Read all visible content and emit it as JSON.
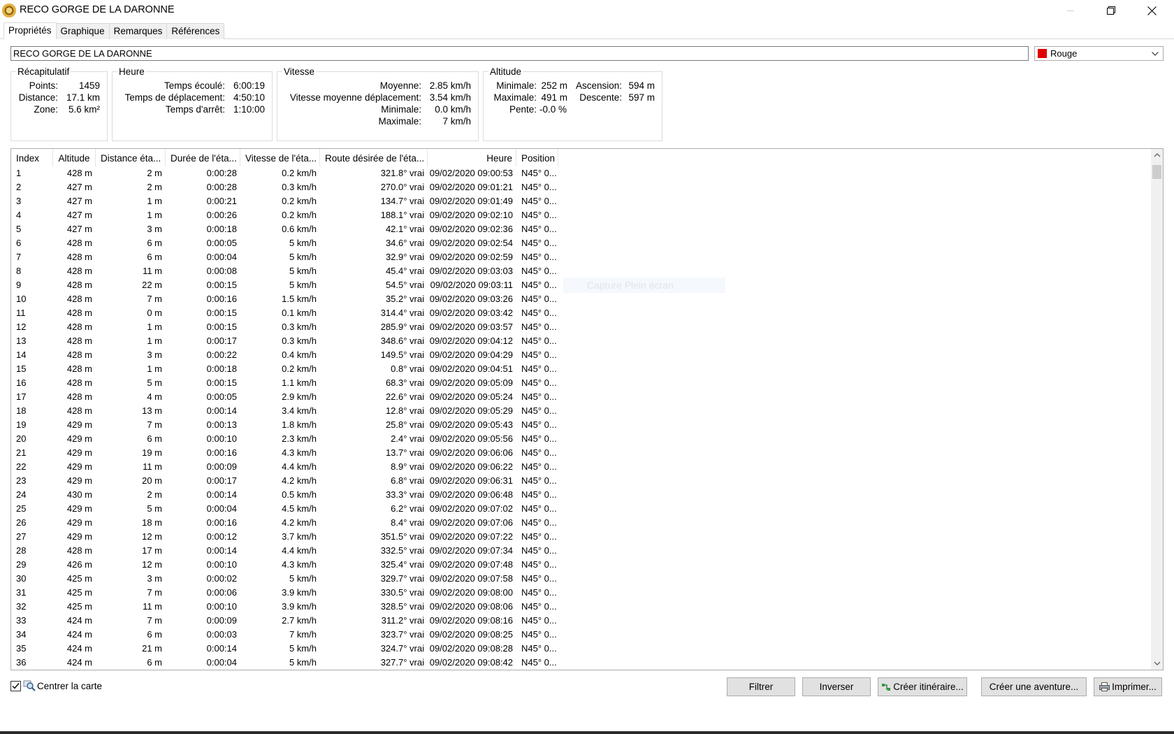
{
  "window": {
    "title": "RECO GORGE DE LA DARONNE",
    "icon": "app-globe-icon"
  },
  "tabs": [
    {
      "label": "Propriétés",
      "active": true
    },
    {
      "label": "Graphique",
      "active": false
    },
    {
      "label": "Remarques",
      "active": false
    },
    {
      "label": "Références",
      "active": false
    }
  ],
  "track": {
    "name": "RECO GORGE DE LA DARONNE",
    "color": {
      "label": "Rouge",
      "hex": "#e00000"
    }
  },
  "summary": {
    "title": "Récapitulatif",
    "points_label": "Points:",
    "points": "1459",
    "distance_label": "Distance:",
    "distance": "17.1 km",
    "zone_label": "Zone:",
    "zone": "5.6 km²"
  },
  "heure": {
    "title": "Heure",
    "ecoule_label": "Temps écoulé:",
    "ecoule": "6:00:19",
    "deplacement_label": "Temps de déplacement:",
    "deplacement": "4:50:10",
    "arret_label": "Temps d'arrêt:",
    "arret": "1:10:00"
  },
  "vitesse": {
    "title": "Vitesse",
    "moyenne_label": "Moyenne:",
    "moyenne": "2.85 km/h",
    "moy_depl_label": "Vitesse moyenne déplacement:",
    "moy_depl": "3.54 km/h",
    "min_label": "Minimale:",
    "min": "0.0 km/h",
    "max_label": "Maximale:",
    "max": "7 km/h"
  },
  "altitude": {
    "title": "Altitude",
    "min_label": "Minimale:",
    "min": "252 m",
    "max_label": "Maximale:",
    "max": "491 m",
    "pente_label": "Pente:",
    "pente": "-0.0 %",
    "ascension_label": "Ascension:",
    "ascension": "594 m",
    "descente_label": "Descente:",
    "descente": "597 m"
  },
  "table": {
    "columns": [
      "Index",
      "Altitude",
      "Distance éta...",
      "Durée de l'éta...",
      "Vitesse de l'éta...",
      "Route désirée de l'éta...",
      "Heure",
      "Position"
    ],
    "rows": [
      [
        "1",
        "428 m",
        "2 m",
        "0:00:28",
        "0.2 km/h",
        "321.8° vrai",
        "09/02/2020 09:00:53",
        "N45° 0..."
      ],
      [
        "2",
        "427 m",
        "2 m",
        "0:00:28",
        "0.3 km/h",
        "270.0° vrai",
        "09/02/2020 09:01:21",
        "N45° 0..."
      ],
      [
        "3",
        "427 m",
        "1 m",
        "0:00:21",
        "0.2 km/h",
        "134.7° vrai",
        "09/02/2020 09:01:49",
        "N45° 0..."
      ],
      [
        "4",
        "427 m",
        "1 m",
        "0:00:26",
        "0.2 km/h",
        "188.1° vrai",
        "09/02/2020 09:02:10",
        "N45° 0..."
      ],
      [
        "5",
        "427 m",
        "3 m",
        "0:00:18",
        "0.6 km/h",
        "42.1° vrai",
        "09/02/2020 09:02:36",
        "N45° 0..."
      ],
      [
        "6",
        "428 m",
        "6 m",
        "0:00:05",
        "5 km/h",
        "34.6° vrai",
        "09/02/2020 09:02:54",
        "N45° 0..."
      ],
      [
        "7",
        "428 m",
        "6 m",
        "0:00:04",
        "5 km/h",
        "32.9° vrai",
        "09/02/2020 09:02:59",
        "N45° 0..."
      ],
      [
        "8",
        "428 m",
        "11 m",
        "0:00:08",
        "5 km/h",
        "45.4° vrai",
        "09/02/2020 09:03:03",
        "N45° 0..."
      ],
      [
        "9",
        "428 m",
        "22 m",
        "0:00:15",
        "5 km/h",
        "54.5° vrai",
        "09/02/2020 09:03:11",
        "N45° 0..."
      ],
      [
        "10",
        "428 m",
        "7 m",
        "0:00:16",
        "1.5 km/h",
        "35.2° vrai",
        "09/02/2020 09:03:26",
        "N45° 0..."
      ],
      [
        "11",
        "428 m",
        "0 m",
        "0:00:15",
        "0.1 km/h",
        "314.4° vrai",
        "09/02/2020 09:03:42",
        "N45° 0..."
      ],
      [
        "12",
        "428 m",
        "1 m",
        "0:00:15",
        "0.3 km/h",
        "285.9° vrai",
        "09/02/2020 09:03:57",
        "N45° 0..."
      ],
      [
        "13",
        "428 m",
        "1 m",
        "0:00:17",
        "0.3 km/h",
        "348.6° vrai",
        "09/02/2020 09:04:12",
        "N45° 0..."
      ],
      [
        "14",
        "428 m",
        "3 m",
        "0:00:22",
        "0.4 km/h",
        "149.5° vrai",
        "09/02/2020 09:04:29",
        "N45° 0..."
      ],
      [
        "15",
        "428 m",
        "1 m",
        "0:00:18",
        "0.2 km/h",
        "0.8° vrai",
        "09/02/2020 09:04:51",
        "N45° 0..."
      ],
      [
        "16",
        "428 m",
        "5 m",
        "0:00:15",
        "1.1 km/h",
        "68.3° vrai",
        "09/02/2020 09:05:09",
        "N45° 0..."
      ],
      [
        "17",
        "428 m",
        "4 m",
        "0:00:05",
        "2.9 km/h",
        "22.6° vrai",
        "09/02/2020 09:05:24",
        "N45° 0..."
      ],
      [
        "18",
        "428 m",
        "13 m",
        "0:00:14",
        "3.4 km/h",
        "12.8° vrai",
        "09/02/2020 09:05:29",
        "N45° 0..."
      ],
      [
        "19",
        "429 m",
        "7 m",
        "0:00:13",
        "1.8 km/h",
        "25.8° vrai",
        "09/02/2020 09:05:43",
        "N45° 0..."
      ],
      [
        "20",
        "429 m",
        "6 m",
        "0:00:10",
        "2.3 km/h",
        "2.4° vrai",
        "09/02/2020 09:05:56",
        "N45° 0..."
      ],
      [
        "21",
        "429 m",
        "19 m",
        "0:00:16",
        "4.3 km/h",
        "13.7° vrai",
        "09/02/2020 09:06:06",
        "N45° 0..."
      ],
      [
        "22",
        "429 m",
        "11 m",
        "0:00:09",
        "4.4 km/h",
        "8.9° vrai",
        "09/02/2020 09:06:22",
        "N45° 0..."
      ],
      [
        "23",
        "429 m",
        "20 m",
        "0:00:17",
        "4.2 km/h",
        "6.8° vrai",
        "09/02/2020 09:06:31",
        "N45° 0..."
      ],
      [
        "24",
        "430 m",
        "2 m",
        "0:00:14",
        "0.5 km/h",
        "33.3° vrai",
        "09/02/2020 09:06:48",
        "N45° 0..."
      ],
      [
        "25",
        "429 m",
        "5 m",
        "0:00:04",
        "4.5 km/h",
        "6.2° vrai",
        "09/02/2020 09:07:02",
        "N45° 0..."
      ],
      [
        "26",
        "429 m",
        "18 m",
        "0:00:16",
        "4.2 km/h",
        "8.4° vrai",
        "09/02/2020 09:07:06",
        "N45° 0..."
      ],
      [
        "27",
        "429 m",
        "12 m",
        "0:00:12",
        "3.7 km/h",
        "351.5° vrai",
        "09/02/2020 09:07:22",
        "N45° 0..."
      ],
      [
        "28",
        "428 m",
        "17 m",
        "0:00:14",
        "4.4 km/h",
        "332.5° vrai",
        "09/02/2020 09:07:34",
        "N45° 0..."
      ],
      [
        "29",
        "426 m",
        "12 m",
        "0:00:10",
        "4.3 km/h",
        "325.4° vrai",
        "09/02/2020 09:07:48",
        "N45° 0..."
      ],
      [
        "30",
        "425 m",
        "3 m",
        "0:00:02",
        "5 km/h",
        "329.7° vrai",
        "09/02/2020 09:07:58",
        "N45° 0..."
      ],
      [
        "31",
        "425 m",
        "7 m",
        "0:00:06",
        "3.9 km/h",
        "330.5° vrai",
        "09/02/2020 09:08:00",
        "N45° 0..."
      ],
      [
        "32",
        "425 m",
        "11 m",
        "0:00:10",
        "3.9 km/h",
        "328.5° vrai",
        "09/02/2020 09:08:06",
        "N45° 0..."
      ],
      [
        "33",
        "424 m",
        "7 m",
        "0:00:09",
        "2.7 km/h",
        "311.2° vrai",
        "09/02/2020 09:08:16",
        "N45° 0..."
      ],
      [
        "34",
        "424 m",
        "6 m",
        "0:00:03",
        "7 km/h",
        "323.7° vrai",
        "09/02/2020 09:08:25",
        "N45° 0..."
      ],
      [
        "35",
        "424 m",
        "21 m",
        "0:00:14",
        "5 km/h",
        "324.7° vrai",
        "09/02/2020 09:08:28",
        "N45° 0..."
      ],
      [
        "36",
        "424 m",
        "6 m",
        "0:00:04",
        "5 km/h",
        "327.7° vrai",
        "09/02/2020 09:08:42",
        "N45° 0..."
      ]
    ]
  },
  "overlay": {
    "capture_tip": "Capture Plein écran"
  },
  "footer": {
    "center_map_label": "Centrer la carte",
    "center_map_checked": true,
    "filter_label": "Filtrer",
    "invert_label": "Inverser",
    "create_route_label": "Créer itinéraire...",
    "create_adventure_label": "Créer une aventure...",
    "print_label": "Imprimer..."
  }
}
